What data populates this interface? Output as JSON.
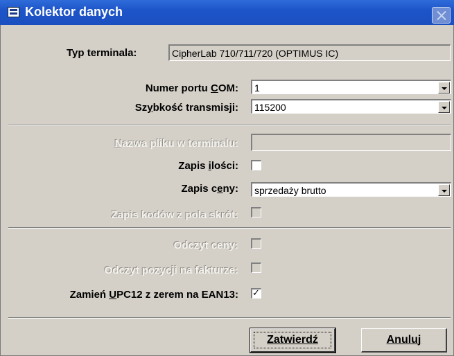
{
  "window": {
    "title": "Kolektor danych"
  },
  "terminal": {
    "label": "Typ terminala:",
    "value": "CipherLab 710/711/720 (OPTIMUS IC)"
  },
  "com_port": {
    "label_prefix": "Numer portu ",
    "label_mnemonic": "C",
    "label_suffix": "OM:",
    "value": "1"
  },
  "speed": {
    "label_prefix": "Sz",
    "label_mnemonic": "y",
    "label_suffix": "bkość transmisji:",
    "value": "115200"
  },
  "file_name": {
    "label_mnemonic": "N",
    "label_suffix": "azwa pliku w terminalu:",
    "value": ""
  },
  "save_qty": {
    "label_prefix": "Zapis ",
    "label_mnemonic": "i",
    "label_suffix": "lości:",
    "checked": false
  },
  "save_price": {
    "label_prefix": "Zapis c",
    "label_mnemonic": "e",
    "label_suffix": "ny:",
    "value": "sprzedaży brutto"
  },
  "save_codes": {
    "label": "Zapis kodów z pola skrót:",
    "checked": false
  },
  "read_price": {
    "label": "Odczyt ceny:",
    "checked": false
  },
  "read_items": {
    "label": "Odczyt pozycji na fakturze:",
    "checked": false
  },
  "upc": {
    "label_prefix": "Zamień ",
    "label_mnemonic": "U",
    "label_suffix": "PC12 z zerem na EAN13:",
    "checked": true,
    "check_glyph": "✓"
  },
  "buttons": {
    "confirm": "Zatwierdź",
    "cancel": "Anuluj"
  },
  "colors": {
    "title_bar": "#1d55c9",
    "dialog_bg": "#d4d0c8"
  },
  "icons": {
    "title": "form-icon",
    "close": "close-icon"
  }
}
